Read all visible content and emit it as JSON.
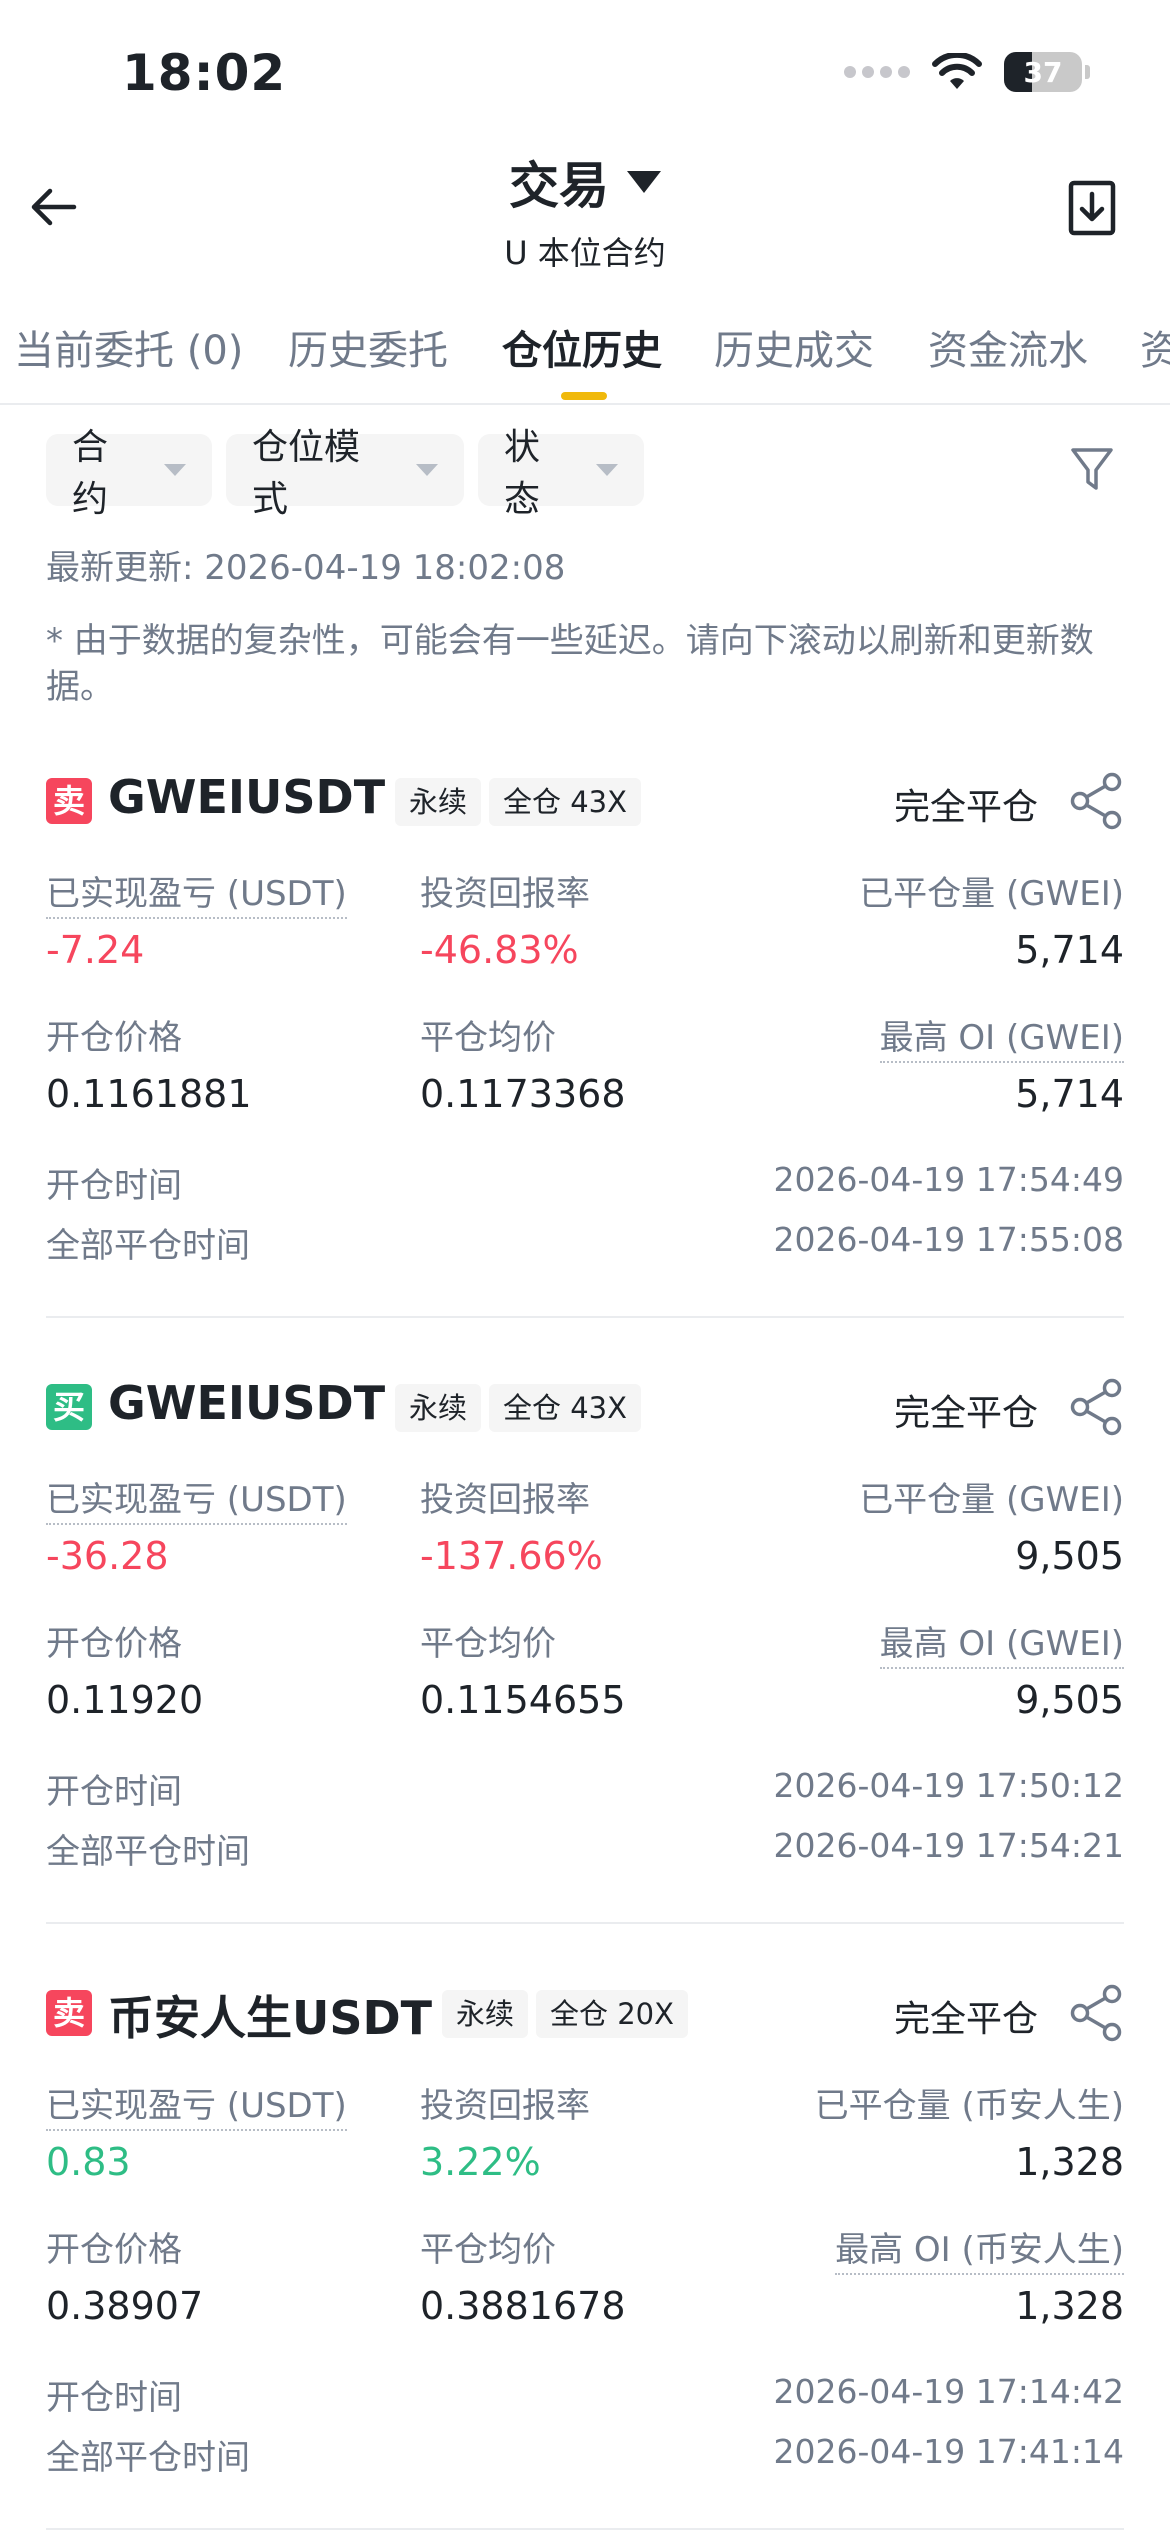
{
  "status_bar": {
    "time": "18:02",
    "battery": "37"
  },
  "header": {
    "title": "交易",
    "subtitle": "U 本位合约"
  },
  "tabs": [
    {
      "label": "当前委托 (0)"
    },
    {
      "label": "历史委托"
    },
    {
      "label": "仓位历史"
    },
    {
      "label": "历史成交"
    },
    {
      "label": "资金流水"
    },
    {
      "label": "资"
    }
  ],
  "filters": {
    "contract": "合约",
    "mode": "仓位模式",
    "status": "状态"
  },
  "updated": "最新更新: 2026-04-19 18:02:08",
  "note": "* 由于数据的复杂性，可能会有一些延迟。请向下滚动以刷新和更新数据。",
  "labels": {
    "pnl": "已实现盈亏 (USDT)",
    "roi": "投资回报率",
    "open_price": "开仓价格",
    "close_avg": "平仓均价",
    "open_time": "开仓时间",
    "close_time": "全部平仓时间"
  },
  "positions": [
    {
      "side": "卖",
      "symbol": "GWEIUSDT",
      "type": "永续",
      "margin": "全仓 43X",
      "status": "完全平仓",
      "pnl": "-7.24",
      "roi": "-46.83%",
      "closed_qty_label": "已平仓量 (GWEI)",
      "closed_qty": "5,714",
      "open_price": "0.1161881",
      "close_avg": "0.1173368",
      "max_oi_label": "最高 OI (GWEI)",
      "max_oi": "5,714",
      "open_time": "2026-04-19 17:54:49",
      "close_time": "2026-04-19 17:55:08"
    },
    {
      "side": "买",
      "symbol": "GWEIUSDT",
      "type": "永续",
      "margin": "全仓 43X",
      "status": "完全平仓",
      "pnl": "-36.28",
      "roi": "-137.66%",
      "closed_qty_label": "已平仓量 (GWEI)",
      "closed_qty": "9,505",
      "open_price": "0.11920",
      "close_avg": "0.1154655",
      "max_oi_label": "最高 OI (GWEI)",
      "max_oi": "9,505",
      "open_time": "2026-04-19 17:50:12",
      "close_time": "2026-04-19 17:54:21"
    },
    {
      "side": "卖",
      "symbol": "币安人生USDT",
      "type": "永续",
      "margin": "全仓 20X",
      "status": "完全平仓",
      "pnl": "0.83",
      "roi": "3.22%",
      "closed_qty_label": "已平仓量 (币安人生)",
      "closed_qty": "1,328",
      "open_price": "0.38907",
      "close_avg": "0.3881678",
      "max_oi_label": "最高 OI (币安人生)",
      "max_oi": "1,328",
      "open_time": "2026-04-19 17:14:42",
      "close_time": "2026-04-19 17:41:14"
    }
  ],
  "colors": {
    "accent": "#f0b90b",
    "sell": "#f6465d",
    "buy": "#2ebd85",
    "muted": "#707a8a"
  }
}
